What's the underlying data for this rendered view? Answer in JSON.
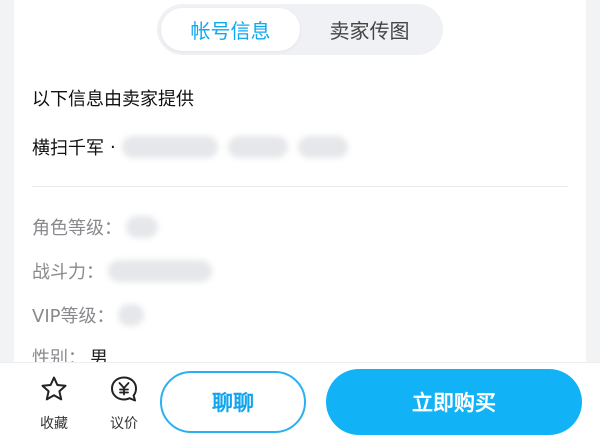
{
  "tabs": [
    {
      "label": "帐号信息",
      "active": true
    },
    {
      "label": "卖家传图",
      "active": false
    }
  ],
  "notice": "以下信息由卖家提供",
  "account": {
    "game_name": "横扫千军",
    "separator": "·"
  },
  "fields": [
    {
      "label": "角色等级："
    },
    {
      "label": "战斗力："
    },
    {
      "label": "VIP等级："
    },
    {
      "label": "性别：",
      "value": "男"
    }
  ],
  "bottom": {
    "favorite_label": "收藏",
    "bargain_label": "议价",
    "chat_label": "聊聊",
    "buy_label": "立即购买"
  },
  "colors": {
    "accent": "#12b3f6",
    "accent_text": "#12a4ee"
  },
  "icons": {
    "favorite": "star-outline-icon",
    "bargain": "yen-bubble-icon"
  }
}
